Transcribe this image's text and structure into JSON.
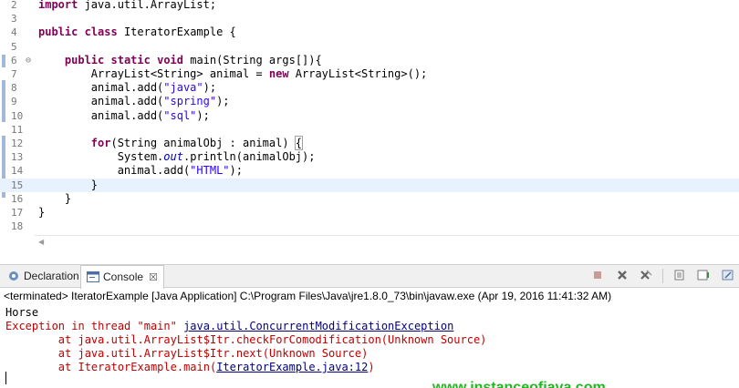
{
  "editor": {
    "lines": [
      {
        "num": "2",
        "tokens": [
          {
            "t": "import",
            "c": "kw"
          },
          {
            "t": " java.util.ArrayList;"
          }
        ]
      },
      {
        "num": "3",
        "tokens": []
      },
      {
        "num": "4",
        "tokens": [
          {
            "t": "public",
            "c": "kw"
          },
          {
            "t": " "
          },
          {
            "t": "class",
            "c": "kw"
          },
          {
            "t": " IteratorExample {"
          }
        ]
      },
      {
        "num": "5",
        "tokens": []
      },
      {
        "num": "6",
        "fold": "⊖",
        "tokens": [
          {
            "t": "    "
          },
          {
            "t": "public",
            "c": "kw"
          },
          {
            "t": " "
          },
          {
            "t": "static",
            "c": "kw"
          },
          {
            "t": " "
          },
          {
            "t": "void",
            "c": "kw"
          },
          {
            "t": " main(String args[]){"
          }
        ]
      },
      {
        "num": "7",
        "tokens": [
          {
            "t": "        ArrayList<String> animal = "
          },
          {
            "t": "new",
            "c": "kw"
          },
          {
            "t": " ArrayList<String>();"
          }
        ]
      },
      {
        "num": "8",
        "tokens": [
          {
            "t": "        animal.add("
          },
          {
            "t": "\"java\"",
            "c": "str"
          },
          {
            "t": ");"
          }
        ]
      },
      {
        "num": "9",
        "tokens": [
          {
            "t": "        animal.add("
          },
          {
            "t": "\"spring\"",
            "c": "str"
          },
          {
            "t": ");"
          }
        ]
      },
      {
        "num": "10",
        "tokens": [
          {
            "t": "        animal.add("
          },
          {
            "t": "\"sql\"",
            "c": "str"
          },
          {
            "t": ");"
          }
        ]
      },
      {
        "num": "11",
        "tokens": []
      },
      {
        "num": "12",
        "tokens": [
          {
            "t": "        "
          },
          {
            "t": "for",
            "c": "kw"
          },
          {
            "t": "(String animalObj : animal) "
          },
          {
            "t": "{",
            "c": "bracket-box"
          }
        ]
      },
      {
        "num": "13",
        "tokens": [
          {
            "t": "            System."
          },
          {
            "t": "out",
            "c": "fld"
          },
          {
            "t": ".println(animalObj);"
          }
        ]
      },
      {
        "num": "14",
        "tokens": [
          {
            "t": "            animal.add("
          },
          {
            "t": "\"HTML\"",
            "c": "str"
          },
          {
            "t": ");"
          }
        ]
      },
      {
        "num": "15",
        "current": true,
        "tokens": [
          {
            "t": "        }"
          }
        ]
      },
      {
        "num": "16",
        "tokens": [
          {
            "t": "    }"
          }
        ]
      },
      {
        "num": "17",
        "tokens": [
          {
            "t": "}"
          }
        ]
      },
      {
        "num": "18",
        "tokens": []
      }
    ]
  },
  "views": {
    "declaration_tab": "Declaration",
    "console_tab": "Console",
    "close_glyph": "☒"
  },
  "toolbar": {
    "icons": [
      "terminate-icon",
      "remove-launch-icon",
      "remove-all-terminated-icon",
      "scroll-lock-icon",
      "word-wrap-icon",
      "pin-console-icon"
    ]
  },
  "console": {
    "header": "<terminated> IteratorExample [Java Application] C:\\Program Files\\Java\\jre1.8.0_73\\bin\\javaw.exe (Apr 19, 2016 11:41:32 AM)",
    "output": [
      {
        "cls": "out-black",
        "parts": [
          {
            "t": "Horse"
          }
        ]
      },
      {
        "cls": "out-red",
        "parts": [
          {
            "t": "Exception in thread \"main\" "
          },
          {
            "t": "java.util.ConcurrentModificationException",
            "link": true
          }
        ]
      },
      {
        "cls": "out-red",
        "parts": [
          {
            "t": "\tat java.util.ArrayList$Itr.checkForComodification(Unknown Source)"
          }
        ]
      },
      {
        "cls": "out-red",
        "parts": [
          {
            "t": "\tat java.util.ArrayList$Itr.next(Unknown Source)"
          }
        ]
      },
      {
        "cls": "out-red",
        "parts": [
          {
            "t": "\tat IteratorExample.main("
          },
          {
            "t": "IteratorExample.java:12",
            "link": true
          },
          {
            "t": ")"
          }
        ]
      }
    ],
    "watermark": "www.instanceofjava.com"
  },
  "colors": {
    "keyword": "#7f0055",
    "string": "#2a00ff",
    "error": "#c00000",
    "current_line": "#e8f2fe",
    "watermark": "#1fb81f"
  }
}
